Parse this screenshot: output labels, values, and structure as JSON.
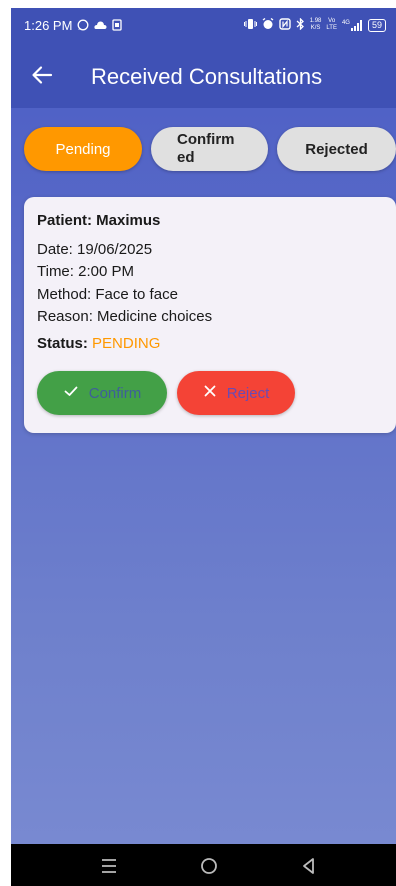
{
  "status_bar": {
    "time": "1:26 PM",
    "speed": "1.98",
    "speed_unit": "K/S",
    "net_type_top": "Vo",
    "net_type_bottom": "LTE",
    "signal": "4G",
    "battery": "59"
  },
  "header": {
    "title": "Received Consultations",
    "back_icon": "arrow-left-icon"
  },
  "tabs": [
    {
      "label": "Pending",
      "active": true
    },
    {
      "label": "Confirmed",
      "active": false
    },
    {
      "label": "Rejected",
      "active": false
    }
  ],
  "consultation": {
    "patient_label": "Patient: Maximus",
    "date_label": "Date: 19/06/2025",
    "time_label": "Time: 2:00 PM",
    "method_label": "Method: Face to face",
    "reason_label": "Reason: Medicine choices",
    "status_label": "Status:",
    "status_value": "PENDING",
    "confirm_label": "Confirm",
    "reject_label": "Reject"
  },
  "colors": {
    "appbar": "#3f51b5",
    "active_tab": "#ff9800",
    "inactive_tab": "#e0e0e0",
    "confirm": "#43a047",
    "reject": "#f44336",
    "status_pending": "#ff9800"
  },
  "nav_bar": {
    "icons": [
      "menu-icon",
      "home-circle-icon",
      "back-triangle-icon"
    ]
  }
}
